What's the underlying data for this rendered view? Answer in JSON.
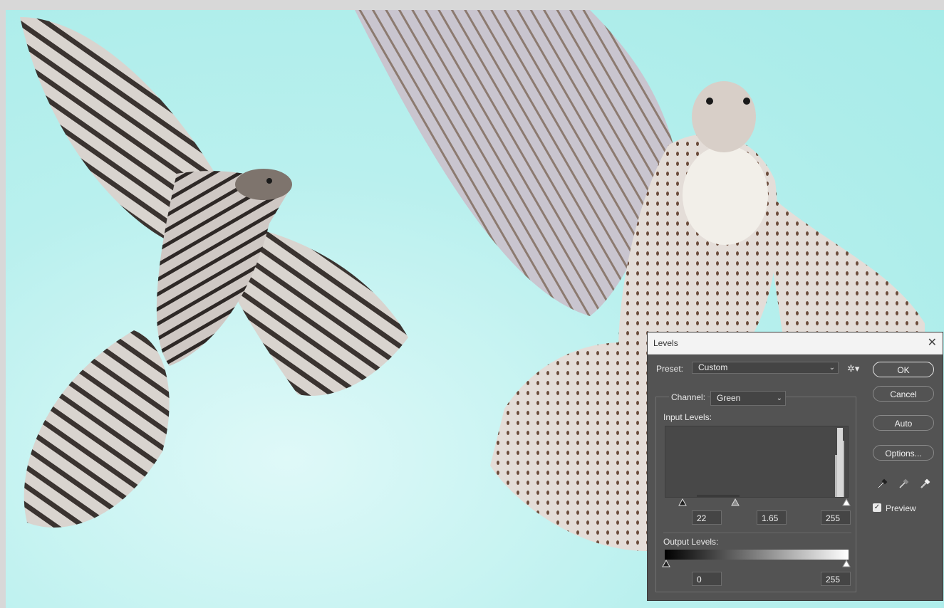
{
  "dialog": {
    "title": "Levels",
    "preset_label": "Preset:",
    "preset_value": "Custom",
    "channel_label": "Channel:",
    "channel_value": "Green",
    "input_levels_label": "Input Levels:",
    "input_black": "22",
    "input_gamma": "1.65",
    "input_white": "255",
    "output_levels_label": "Output Levels:",
    "output_black": "0",
    "output_white": "255",
    "buttons": {
      "ok": "OK",
      "cancel": "Cancel",
      "auto": "Auto",
      "options": "Options..."
    },
    "preview_label": "Preview",
    "preview_checked": true
  },
  "icons": {
    "close": "close-icon",
    "settings": "gear-icon",
    "pickers": [
      "black-point-eyedropper-icon",
      "gray-point-eyedropper-icon",
      "white-point-eyedropper-icon"
    ]
  },
  "colors": {
    "sky": "#a6ebe8",
    "dialog_bg": "#535353"
  }
}
